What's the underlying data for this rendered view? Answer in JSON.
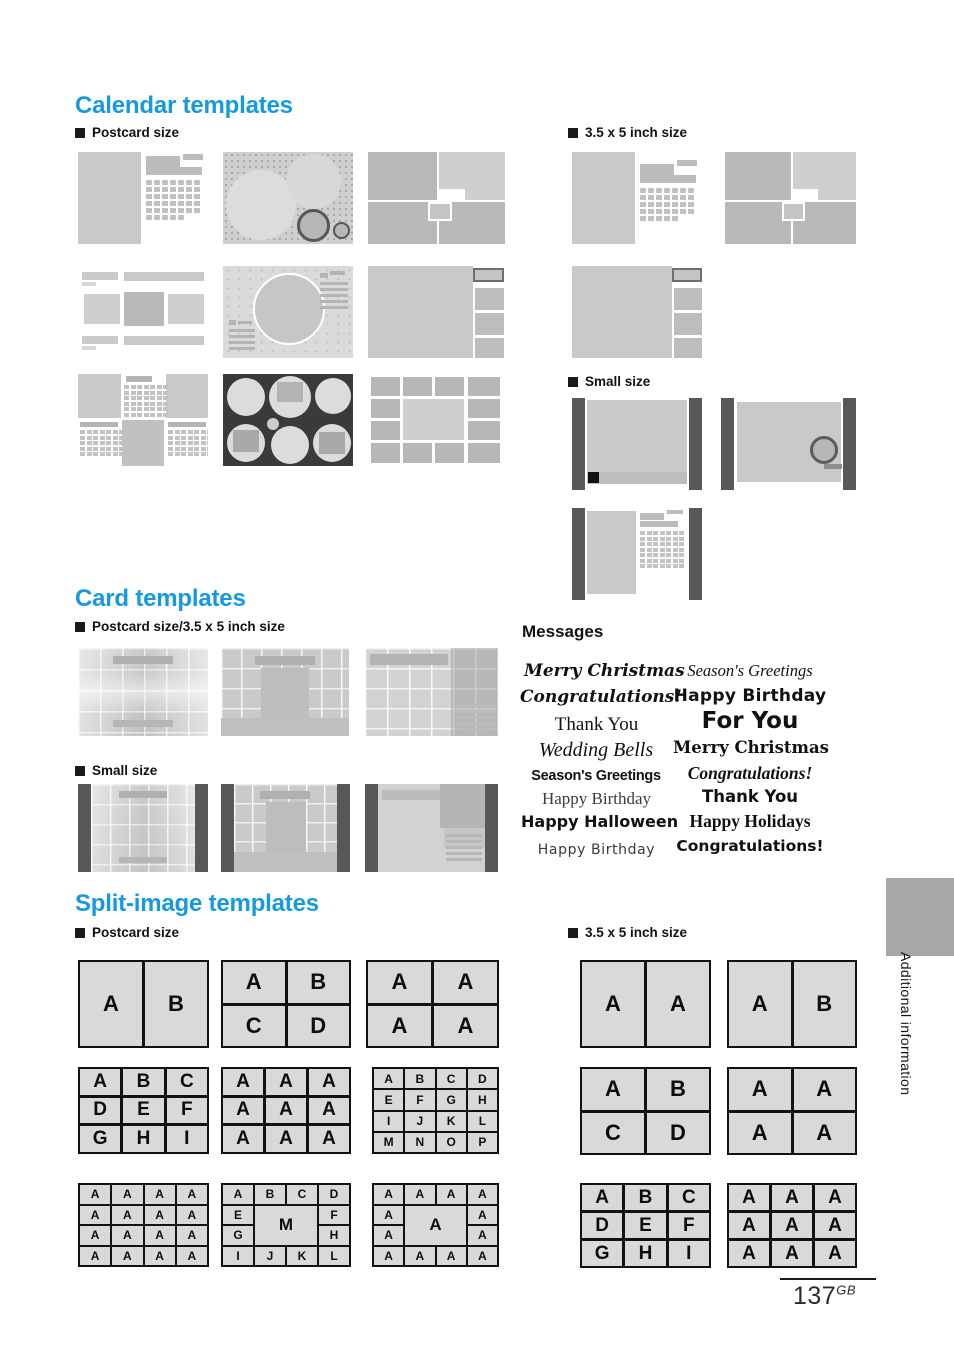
{
  "page": {
    "number": "137",
    "region_code": "GB",
    "side_tab_label": "Additional information"
  },
  "sections": [
    {
      "id": "calendar",
      "title": "Calendar templates",
      "groups": [
        {
          "id": "calendar-postcard",
          "label": "Postcard size",
          "thumb_count": 9
        },
        {
          "id": "calendar-35x5",
          "label": "3.5 x 5 inch size",
          "thumb_count": 3
        },
        {
          "id": "calendar-small",
          "label": "Small size",
          "thumb_count": 3
        }
      ]
    },
    {
      "id": "card",
      "title": "Card templates",
      "groups": [
        {
          "id": "card-postcard-35x5",
          "label": "Postcard size/3.5 x 5 inch size",
          "thumb_count": 3
        },
        {
          "id": "card-small",
          "label": "Small size",
          "thumb_count": 3
        }
      ]
    },
    {
      "id": "split",
      "title": "Split-image templates",
      "groups": [
        {
          "id": "split-postcard",
          "label": "Postcard size",
          "thumb_count": 9
        },
        {
          "id": "split-35x5",
          "label": "3.5 x 5 inch size",
          "thumb_count": 6
        }
      ]
    }
  ],
  "messages": {
    "title": "Messages",
    "column_left": [
      {
        "text": "Merry Christmas",
        "style": "script-bold-italic"
      },
      {
        "text": "Congratulations!",
        "style": "script-bold-italic"
      },
      {
        "text": "Thank You",
        "style": "serif-regular"
      },
      {
        "text": "Wedding Bells",
        "style": "serif-italic-light"
      },
      {
        "text": "Season's Greetings",
        "style": "sans-heavy-condensed"
      },
      {
        "text": "Happy Birthday",
        "style": "serif-light"
      },
      {
        "text": "Happy Halloween",
        "style": "sans-bold"
      },
      {
        "text": "Happy Birthday",
        "style": "thin-script"
      }
    ],
    "column_right": [
      {
        "text": "Season's Greetings",
        "style": "serif-italic"
      },
      {
        "text": "Happy Birthday",
        "style": "sans-bold-wide"
      },
      {
        "text": "For You",
        "style": "sans-extrabold"
      },
      {
        "text": "Merry Christmas",
        "style": "blackletter"
      },
      {
        "text": "Congratulations!",
        "style": "serif-bold-italic"
      },
      {
        "text": "Thank You",
        "style": "sans-bold"
      },
      {
        "text": "Happy Holidays",
        "style": "serif-bold"
      },
      {
        "text": "Congratulations!",
        "style": "sans-bold"
      }
    ]
  },
  "split_templates": {
    "postcard": [
      {
        "id": "sp-1",
        "cols": 2,
        "rows": 1,
        "letters": [
          "A",
          "B"
        ],
        "font": 22
      },
      {
        "id": "sp-2",
        "cols": 2,
        "rows": 2,
        "letters": [
          "A",
          "B",
          "C",
          "D"
        ],
        "font": 22
      },
      {
        "id": "sp-3",
        "cols": 2,
        "rows": 2,
        "letters": [
          "A",
          "A",
          "A",
          "A"
        ],
        "font": 22
      },
      {
        "id": "sp-4",
        "cols": 3,
        "rows": 3,
        "letters": [
          "A",
          "B",
          "C",
          "D",
          "E",
          "F",
          "G",
          "H",
          "I"
        ],
        "font": 19
      },
      {
        "id": "sp-5",
        "cols": 3,
        "rows": 3,
        "letters": [
          "A",
          "A",
          "A",
          "A",
          "A",
          "A",
          "A",
          "A",
          "A"
        ],
        "font": 19
      },
      {
        "id": "sp-6",
        "cols": 4,
        "rows": 4,
        "letters": [
          "A",
          "B",
          "C",
          "D",
          "E",
          "F",
          "G",
          "H",
          "I",
          "J",
          "K",
          "L",
          "M",
          "N",
          "O",
          "P"
        ],
        "font": 12
      },
      {
        "id": "sp-7",
        "cols": 4,
        "rows": 4,
        "letters": [
          "A",
          "A",
          "A",
          "A",
          "A",
          "A",
          "A",
          "A",
          "A",
          "A",
          "A",
          "A",
          "A",
          "A",
          "A",
          "A"
        ],
        "font": 12
      },
      {
        "id": "sp-8",
        "type": "center",
        "letters": [
          "A",
          "B",
          "C",
          "D",
          "E",
          "F",
          "G",
          "H",
          "I",
          "J",
          "K",
          "L"
        ],
        "center_letter": "M",
        "font": 12
      },
      {
        "id": "sp-9",
        "type": "center",
        "letters": [
          "A",
          "A",
          "A",
          "A",
          "A",
          "A",
          "A",
          "A",
          "A",
          "A",
          "A",
          "A"
        ],
        "center_letter": "A",
        "font": 12
      }
    ],
    "inch35x5": [
      {
        "id": "s5-1",
        "cols": 2,
        "rows": 1,
        "letters": [
          "A",
          "A"
        ],
        "font": 22
      },
      {
        "id": "s5-2",
        "cols": 2,
        "rows": 1,
        "letters": [
          "A",
          "B"
        ],
        "font": 22
      },
      {
        "id": "s5-3",
        "cols": 2,
        "rows": 2,
        "letters": [
          "A",
          "B",
          "C",
          "D"
        ],
        "font": 22
      },
      {
        "id": "s5-4",
        "cols": 2,
        "rows": 2,
        "letters": [
          "A",
          "A",
          "A",
          "A"
        ],
        "font": 22
      },
      {
        "id": "s5-5",
        "cols": 3,
        "rows": 3,
        "letters": [
          "A",
          "B",
          "C",
          "D",
          "E",
          "F",
          "G",
          "H",
          "I"
        ],
        "font": 19
      },
      {
        "id": "s5-6",
        "cols": 3,
        "rows": 3,
        "letters": [
          "A",
          "A",
          "A",
          "A",
          "A",
          "A",
          "A",
          "A",
          "A"
        ],
        "font": 19
      }
    ]
  },
  "colors": {
    "heading_blue": "#159ae0",
    "thumb_gray": "#c9c9c9",
    "dark_bar": "#585858",
    "split_cell": "#d9d9d9",
    "side_tab": "#a8a8a8"
  }
}
